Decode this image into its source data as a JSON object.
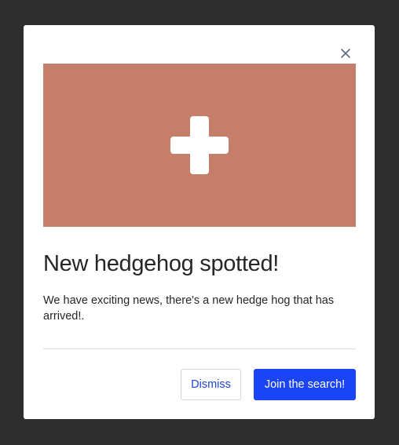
{
  "modal": {
    "close_icon": "close-icon",
    "hero": {
      "background_color": "#c47e69",
      "icon": "plus-icon"
    },
    "title": "New hedgehog spotted!",
    "body": "We have exciting news, there's a new hedge hog that has arrived!.",
    "buttons": {
      "dismiss_label": "Dismiss",
      "join_label": "Join the search!"
    }
  },
  "colors": {
    "backdrop": "#2e2e2e",
    "primary": "#1b44f5",
    "link": "#1c45d8"
  }
}
